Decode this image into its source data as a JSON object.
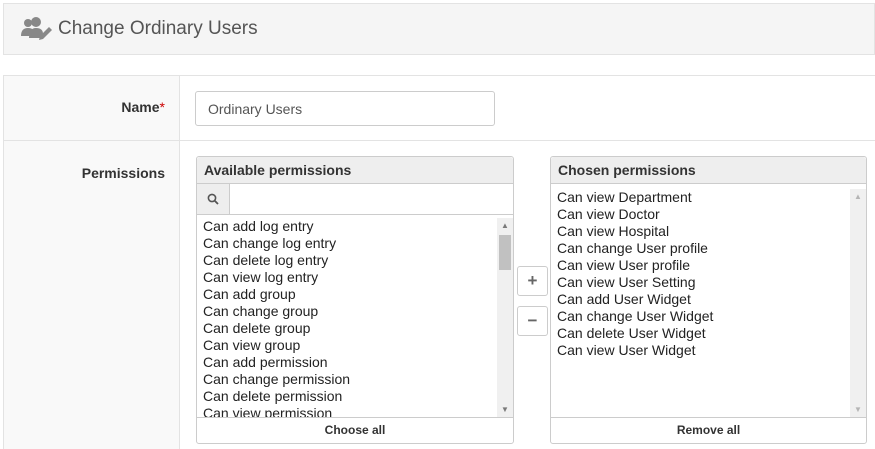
{
  "header": {
    "title": "Change Ordinary Users",
    "icon": "users-edit-icon"
  },
  "form": {
    "name_label": "Name",
    "required_marker": "*",
    "name_value": "Ordinary Users",
    "permissions_label": "Permissions"
  },
  "available": {
    "title": "Available permissions",
    "search_icon": "search-icon",
    "filter_value": "",
    "items": [
      "Can add log entry",
      "Can change log entry",
      "Can delete log entry",
      "Can view log entry",
      "Can add group",
      "Can change group",
      "Can delete group",
      "Can view group",
      "Can add permission",
      "Can change permission",
      "Can delete permission",
      "Can view permission"
    ],
    "footer": "Choose all"
  },
  "controls": {
    "add": "+",
    "remove": "−"
  },
  "chosen": {
    "title": "Chosen permissions",
    "items": [
      "Can view Department",
      "Can view Doctor",
      "Can view Hospital",
      "Can change User profile",
      "Can view User profile",
      "Can view User Setting",
      "Can add User Widget",
      "Can change User Widget",
      "Can delete User Widget",
      "Can view User Widget"
    ],
    "footer": "Remove all"
  }
}
